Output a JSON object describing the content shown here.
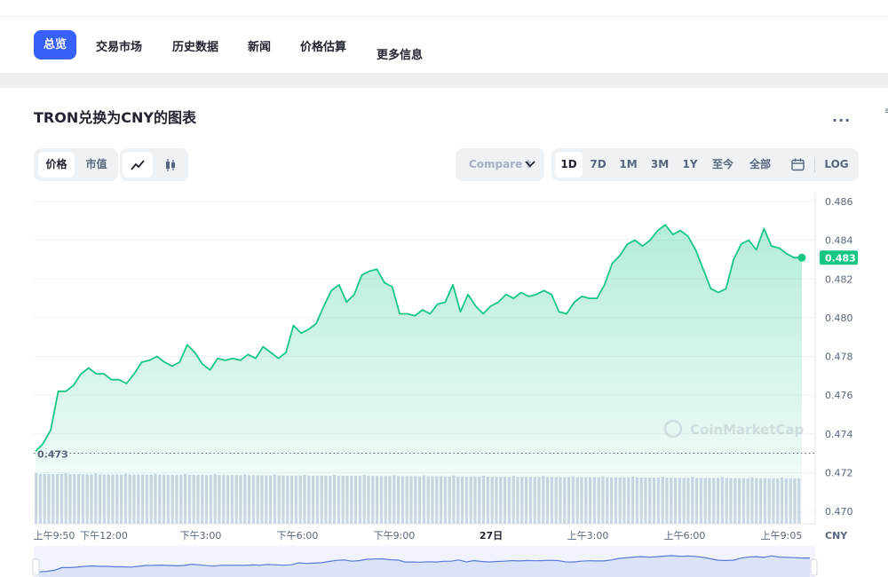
{
  "nav": {
    "tabs": [
      {
        "label": "总览",
        "active": true
      },
      {
        "label": "交易市场",
        "active": false
      },
      {
        "label": "历史数据",
        "active": false
      },
      {
        "label": "新闻",
        "active": false
      },
      {
        "label": "价格估算",
        "active": false
      },
      {
        "label": "更多信息",
        "active": false
      }
    ]
  },
  "title": "TRON兑换为CNY的图表",
  "more_label": "...",
  "edge_mark": "≡",
  "toolbar": {
    "metric_tabs": [
      {
        "label": "价格",
        "selected": true
      },
      {
        "label": "市值",
        "selected": false
      }
    ],
    "chart_type_icons": [
      "line-chart-icon",
      "candlestick-icon"
    ],
    "compare_label": "Compare t",
    "ranges": [
      {
        "label": "1D",
        "selected": true
      },
      {
        "label": "7D",
        "selected": false
      },
      {
        "label": "1M",
        "selected": false
      },
      {
        "label": "3M",
        "selected": false
      },
      {
        "label": "1Y",
        "selected": false
      },
      {
        "label": "至今",
        "selected": false
      },
      {
        "label": "全部",
        "selected": false
      }
    ],
    "calendar_icon": "calendar-icon",
    "log_label": "LOG"
  },
  "watermark": "CoinMarketCap",
  "colors": {
    "accent": "#3861fb",
    "line": "#16c784",
    "volume": "#cfd6e4",
    "navigator": "#5b7bd6"
  },
  "chart_data": {
    "type": "area",
    "currency_label": "CNY",
    "ylim": [
      0.4695,
      0.4865
    ],
    "y_ticks": [
      "0.486",
      "0.484",
      "0.482",
      "0.480",
      "0.478",
      "0.476",
      "0.474",
      "0.472",
      "0.470"
    ],
    "x_ticks": [
      "上午9:50",
      "下午12:00",
      "下午3:00",
      "下午6:00",
      "下午9:00",
      "27日",
      "上午3:00",
      "上午6:00",
      "上午9:05"
    ],
    "x_ticks_bold": [
      "27日"
    ],
    "current_value": "0.483",
    "open_value": "0.473",
    "series": [
      {
        "values": [
          0.4731,
          0.4735,
          0.4742,
          0.4762,
          0.4762,
          0.4765,
          0.4771,
          0.4774,
          0.4771,
          0.4771,
          0.4768,
          0.4768,
          0.4766,
          0.4771,
          0.4777,
          0.4778,
          0.478,
          0.4777,
          0.4775,
          0.4777,
          0.4786,
          0.4782,
          0.4776,
          0.4773,
          0.4779,
          0.4778,
          0.4779,
          0.4778,
          0.4781,
          0.4779,
          0.4785,
          0.4782,
          0.4779,
          0.4782,
          0.4796,
          0.4792,
          0.4794,
          0.4797,
          0.4806,
          0.4814,
          0.4817,
          0.4808,
          0.4812,
          0.4822,
          0.4824,
          0.4825,
          0.4818,
          0.4816,
          0.4802,
          0.4802,
          0.4801,
          0.4804,
          0.4802,
          0.4807,
          0.4808,
          0.4817,
          0.4803,
          0.4812,
          0.4806,
          0.4802,
          0.4806,
          0.4808,
          0.4812,
          0.481,
          0.4813,
          0.4811,
          0.4812,
          0.4814,
          0.4812,
          0.4803,
          0.4802,
          0.4808,
          0.4811,
          0.481,
          0.481,
          0.4817,
          0.4828,
          0.4832,
          0.4838,
          0.484,
          0.4837,
          0.484,
          0.4845,
          0.4848,
          0.4843,
          0.4845,
          0.4842,
          0.4835,
          0.4825,
          0.4815,
          0.4813,
          0.4815,
          0.483,
          0.4838,
          0.484,
          0.4835,
          0.4846,
          0.4837,
          0.4836,
          0.4833,
          0.4831,
          0.4831
        ]
      }
    ],
    "volume_bars": "uniform-high",
    "navigator": true
  }
}
